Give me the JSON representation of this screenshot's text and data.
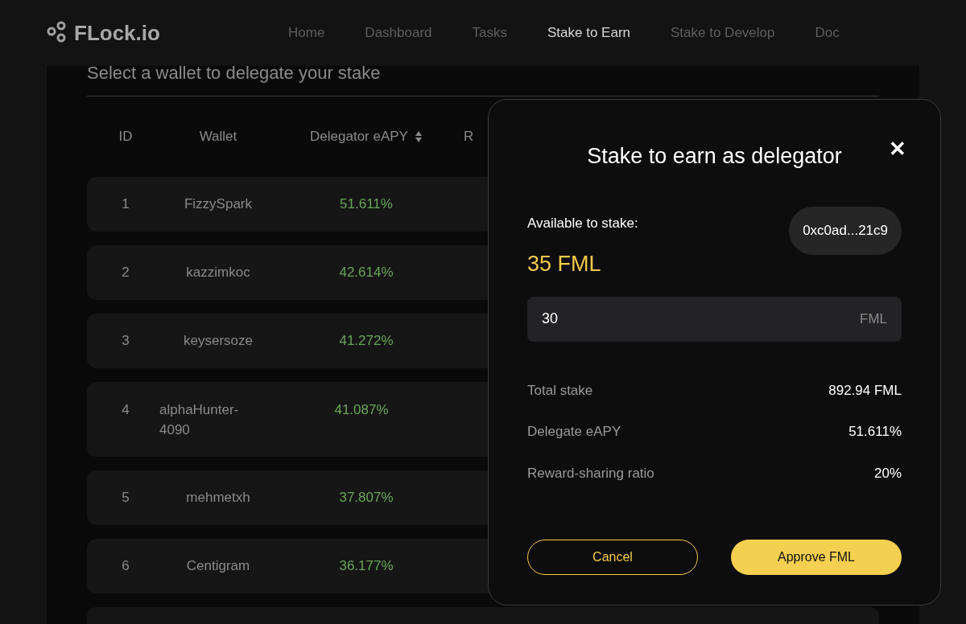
{
  "nav": {
    "logo": "FLock.io",
    "links": [
      {
        "label": "Home",
        "selected": false
      },
      {
        "label": "Dashboard",
        "selected": false
      },
      {
        "label": "Tasks",
        "selected": false
      },
      {
        "label": "Stake to Earn",
        "selected": true
      },
      {
        "label": "Stake to Develop",
        "selected": false
      },
      {
        "label": "Doc",
        "selected": false
      }
    ]
  },
  "section_title": "Select a wallet to delegate your stake",
  "table": {
    "columns": [
      "ID",
      "Wallet",
      "Delegator eAPY",
      "R"
    ],
    "rows": [
      {
        "id": "1",
        "wallet": "FizzySpark",
        "eapy": "51.611%"
      },
      {
        "id": "2",
        "wallet": "kazzimkoc",
        "eapy": "42.614%"
      },
      {
        "id": "3",
        "wallet": "keysersoze",
        "eapy": "41.272%"
      },
      {
        "id": "4",
        "wallet": "alphaHunter-4090",
        "eapy": "41.087%"
      },
      {
        "id": "5",
        "wallet": "mehmetxh",
        "eapy": "37.807%"
      },
      {
        "id": "6",
        "wallet": "Centigram",
        "eapy": "36.177%"
      }
    ]
  },
  "modal": {
    "title": "Stake to earn as delegator",
    "close": "✕",
    "available_label": "Available to stake:",
    "available_amount": "35 FML",
    "address": "0xc0ad...21c9",
    "amount_input": {
      "value": "30",
      "unit": "FML"
    },
    "stats": [
      {
        "label": "Total stake",
        "value": "892.94 FML"
      },
      {
        "label": "Delegate eAPY",
        "value": "51.611%"
      },
      {
        "label": "Reward-sharing ratio",
        "value": "20%"
      }
    ],
    "buttons": [
      {
        "label": "Cancel",
        "kind": "outline"
      },
      {
        "label": "Approve FML",
        "kind": "primary"
      }
    ]
  }
}
